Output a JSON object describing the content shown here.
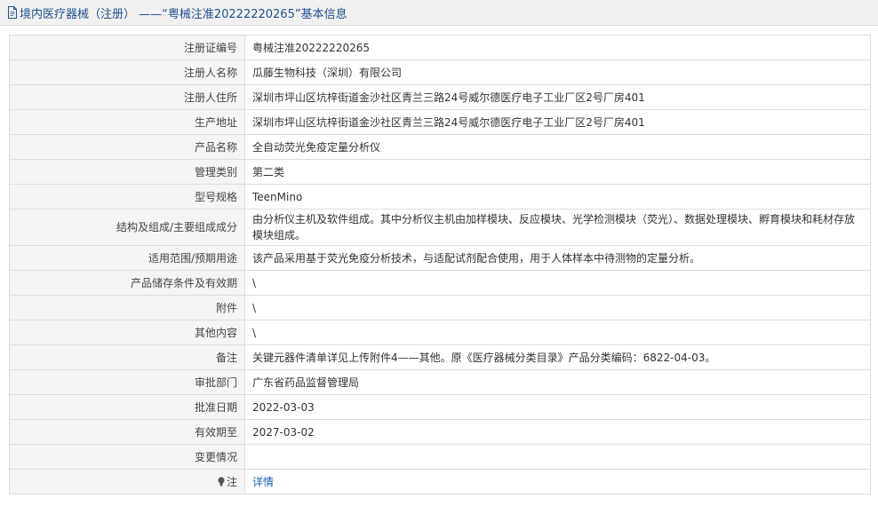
{
  "header": {
    "title": "境内医疗器械（注册） ——“粤械注准20222220265”基本信息"
  },
  "icons": {
    "header": "document-icon",
    "note": "lightbulb-icon"
  },
  "colors": {
    "header_text": "#1e4f8e",
    "link": "#1a5fb4",
    "label_bg": "#f5f5f5",
    "border": "#dddddd"
  },
  "rows": [
    {
      "label": "注册证编号",
      "value": "粤械注准20222220265"
    },
    {
      "label": "注册人名称",
      "value": "瓜藤生物科技（深圳）有限公司"
    },
    {
      "label": "注册人住所",
      "value": "深圳市坪山区坑梓街道金沙社区青兰三路24号威尔德医疗电子工业厂区2号厂房401"
    },
    {
      "label": "生产地址",
      "value": "深圳市坪山区坑梓街道金沙社区青兰三路24号威尔德医疗电子工业厂区2号厂房401"
    },
    {
      "label": "产品名称",
      "value": "全自动荧光免疫定量分析仪"
    },
    {
      "label": "管理类别",
      "value": "第二类"
    },
    {
      "label": "型号规格",
      "value": "TeenMino"
    },
    {
      "label": "结构及组成/主要组成成分",
      "value": "由分析仪主机及软件组成。其中分析仪主机由加样模块、反应模块、光学检测模块（荧光）、数据处理模块、孵育模块和耗材存放模块组成。"
    },
    {
      "label": "适用范围/预期用途",
      "value": "该产品采用基于荧光免疫分析技术，与适配试剂配合使用，用于人体样本中待测物的定量分析。"
    },
    {
      "label": "产品储存条件及有效期",
      "value": "\\"
    },
    {
      "label": "附件",
      "value": "\\"
    },
    {
      "label": "其他内容",
      "value": "\\"
    },
    {
      "label": "备注",
      "value": "关键元器件清单详见上传附件4——其他。原《医疗器械分类目录》产品分类编码：6822-04-03。"
    },
    {
      "label": "审批部门",
      "value": "广东省药品监督管理局"
    },
    {
      "label": "批准日期",
      "value": "2022-03-03"
    },
    {
      "label": "有效期至",
      "value": "2027-03-02"
    },
    {
      "label": "变更情况",
      "value": ""
    }
  ],
  "note": {
    "label": "注",
    "link": "详情"
  }
}
